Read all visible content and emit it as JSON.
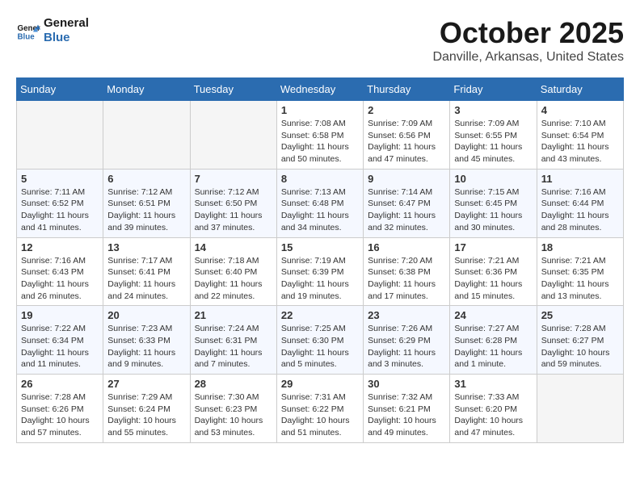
{
  "header": {
    "logo_line1": "General",
    "logo_line2": "Blue",
    "month": "October 2025",
    "location": "Danville, Arkansas, United States"
  },
  "weekdays": [
    "Sunday",
    "Monday",
    "Tuesday",
    "Wednesday",
    "Thursday",
    "Friday",
    "Saturday"
  ],
  "weeks": [
    [
      {
        "day": "",
        "info": ""
      },
      {
        "day": "",
        "info": ""
      },
      {
        "day": "",
        "info": ""
      },
      {
        "day": "1",
        "info": "Sunrise: 7:08 AM\nSunset: 6:58 PM\nDaylight: 11 hours and 50 minutes."
      },
      {
        "day": "2",
        "info": "Sunrise: 7:09 AM\nSunset: 6:56 PM\nDaylight: 11 hours and 47 minutes."
      },
      {
        "day": "3",
        "info": "Sunrise: 7:09 AM\nSunset: 6:55 PM\nDaylight: 11 hours and 45 minutes."
      },
      {
        "day": "4",
        "info": "Sunrise: 7:10 AM\nSunset: 6:54 PM\nDaylight: 11 hours and 43 minutes."
      }
    ],
    [
      {
        "day": "5",
        "info": "Sunrise: 7:11 AM\nSunset: 6:52 PM\nDaylight: 11 hours and 41 minutes."
      },
      {
        "day": "6",
        "info": "Sunrise: 7:12 AM\nSunset: 6:51 PM\nDaylight: 11 hours and 39 minutes."
      },
      {
        "day": "7",
        "info": "Sunrise: 7:12 AM\nSunset: 6:50 PM\nDaylight: 11 hours and 37 minutes."
      },
      {
        "day": "8",
        "info": "Sunrise: 7:13 AM\nSunset: 6:48 PM\nDaylight: 11 hours and 34 minutes."
      },
      {
        "day": "9",
        "info": "Sunrise: 7:14 AM\nSunset: 6:47 PM\nDaylight: 11 hours and 32 minutes."
      },
      {
        "day": "10",
        "info": "Sunrise: 7:15 AM\nSunset: 6:45 PM\nDaylight: 11 hours and 30 minutes."
      },
      {
        "day": "11",
        "info": "Sunrise: 7:16 AM\nSunset: 6:44 PM\nDaylight: 11 hours and 28 minutes."
      }
    ],
    [
      {
        "day": "12",
        "info": "Sunrise: 7:16 AM\nSunset: 6:43 PM\nDaylight: 11 hours and 26 minutes."
      },
      {
        "day": "13",
        "info": "Sunrise: 7:17 AM\nSunset: 6:41 PM\nDaylight: 11 hours and 24 minutes."
      },
      {
        "day": "14",
        "info": "Sunrise: 7:18 AM\nSunset: 6:40 PM\nDaylight: 11 hours and 22 minutes."
      },
      {
        "day": "15",
        "info": "Sunrise: 7:19 AM\nSunset: 6:39 PM\nDaylight: 11 hours and 19 minutes."
      },
      {
        "day": "16",
        "info": "Sunrise: 7:20 AM\nSunset: 6:38 PM\nDaylight: 11 hours and 17 minutes."
      },
      {
        "day": "17",
        "info": "Sunrise: 7:21 AM\nSunset: 6:36 PM\nDaylight: 11 hours and 15 minutes."
      },
      {
        "day": "18",
        "info": "Sunrise: 7:21 AM\nSunset: 6:35 PM\nDaylight: 11 hours and 13 minutes."
      }
    ],
    [
      {
        "day": "19",
        "info": "Sunrise: 7:22 AM\nSunset: 6:34 PM\nDaylight: 11 hours and 11 minutes."
      },
      {
        "day": "20",
        "info": "Sunrise: 7:23 AM\nSunset: 6:33 PM\nDaylight: 11 hours and 9 minutes."
      },
      {
        "day": "21",
        "info": "Sunrise: 7:24 AM\nSunset: 6:31 PM\nDaylight: 11 hours and 7 minutes."
      },
      {
        "day": "22",
        "info": "Sunrise: 7:25 AM\nSunset: 6:30 PM\nDaylight: 11 hours and 5 minutes."
      },
      {
        "day": "23",
        "info": "Sunrise: 7:26 AM\nSunset: 6:29 PM\nDaylight: 11 hours and 3 minutes."
      },
      {
        "day": "24",
        "info": "Sunrise: 7:27 AM\nSunset: 6:28 PM\nDaylight: 11 hours and 1 minute."
      },
      {
        "day": "25",
        "info": "Sunrise: 7:28 AM\nSunset: 6:27 PM\nDaylight: 10 hours and 59 minutes."
      }
    ],
    [
      {
        "day": "26",
        "info": "Sunrise: 7:28 AM\nSunset: 6:26 PM\nDaylight: 10 hours and 57 minutes."
      },
      {
        "day": "27",
        "info": "Sunrise: 7:29 AM\nSunset: 6:24 PM\nDaylight: 10 hours and 55 minutes."
      },
      {
        "day": "28",
        "info": "Sunrise: 7:30 AM\nSunset: 6:23 PM\nDaylight: 10 hours and 53 minutes."
      },
      {
        "day": "29",
        "info": "Sunrise: 7:31 AM\nSunset: 6:22 PM\nDaylight: 10 hours and 51 minutes."
      },
      {
        "day": "30",
        "info": "Sunrise: 7:32 AM\nSunset: 6:21 PM\nDaylight: 10 hours and 49 minutes."
      },
      {
        "day": "31",
        "info": "Sunrise: 7:33 AM\nSunset: 6:20 PM\nDaylight: 10 hours and 47 minutes."
      },
      {
        "day": "",
        "info": ""
      }
    ]
  ]
}
